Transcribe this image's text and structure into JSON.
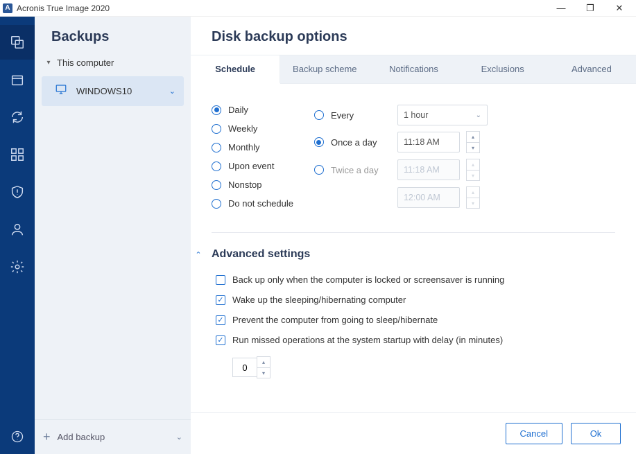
{
  "app": {
    "title": "Acronis True Image 2020",
    "icon_letter": "A"
  },
  "sidebar": {
    "header": "Backups",
    "root_label": "This computer",
    "item": {
      "label": "WINDOWS10"
    },
    "add_label": "Add backup"
  },
  "content": {
    "title": "Disk backup options",
    "tabs": [
      "Schedule",
      "Backup scheme",
      "Notifications",
      "Exclusions",
      "Advanced"
    ],
    "schedule": {
      "freq": {
        "daily": "Daily",
        "weekly": "Weekly",
        "monthly": "Monthly",
        "upon_event": "Upon event",
        "nonstop": "Nonstop",
        "do_not": "Do not schedule"
      },
      "mode": {
        "every": "Every",
        "once": "Once a day",
        "twice": "Twice a day"
      },
      "every_value": "1 hour",
      "once_value": "11:18 AM",
      "twice_value1": "11:18 AM",
      "twice_value2": "12:00 AM"
    },
    "advanced": {
      "header": "Advanced settings",
      "opt1": "Back up only when the computer is locked or screensaver is running",
      "opt2": "Wake up the sleeping/hibernating computer",
      "opt3": "Prevent the computer from going to sleep/hibernate",
      "opt4": "Run missed operations at the system startup with delay (in minutes)",
      "delay_value": "0"
    },
    "footer": {
      "cancel": "Cancel",
      "ok": "Ok"
    }
  }
}
